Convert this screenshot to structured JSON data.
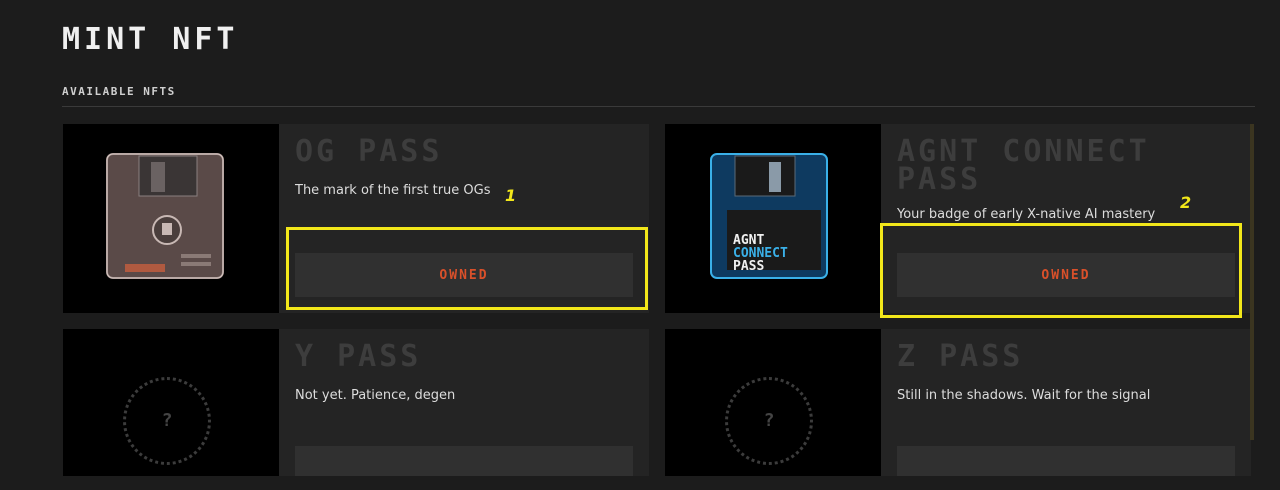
{
  "header": {
    "title": "MINT NFT"
  },
  "section": {
    "label": "AVAILABLE NFTS"
  },
  "cards": [
    {
      "title": "OG PASS",
      "description": "The mark of the first true OGs",
      "button": "OWNED",
      "annotation": "1"
    },
    {
      "title": "AGNT CONNECT PASS",
      "description": "Your badge of early X-native AI mastery",
      "button": "OWNED",
      "annotation": "2",
      "art_text": [
        "AGNT",
        "CONNECT",
        "PASS"
      ]
    },
    {
      "title": "Y PASS",
      "description": "Not yet. Patience, degen",
      "placeholder": "?"
    },
    {
      "title": "Z PASS",
      "description": "Still in the shadows. Wait for the signal",
      "placeholder": "?"
    }
  ],
  "colors": {
    "accent": "#d9502a",
    "highlight": "#f2e71a",
    "background": "#1c1c1c",
    "card": "#242424"
  }
}
